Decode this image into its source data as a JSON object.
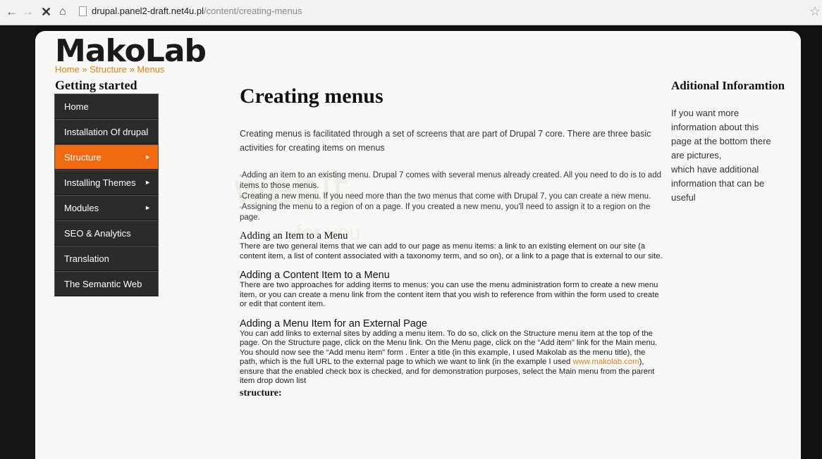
{
  "browser": {
    "back_icon": "←",
    "forward_icon": "→",
    "stop_icon": "✕",
    "home_icon": "⌂",
    "url_host": "drupal.panel2-draft.net4u.pl",
    "url_path": "/content/creating-menus",
    "star_icon": "☆"
  },
  "site": {
    "logo": "MakoLab",
    "breadcrumb": [
      "Home",
      "Structure",
      "Menus"
    ],
    "breadcrumb_sep": "»",
    "watermark": "webit",
    "watermark_sub": "for you"
  },
  "sidebar": {
    "title": "Getting started",
    "items": [
      {
        "label": "Home",
        "arrow": ""
      },
      {
        "label": "Installation Of drupal",
        "arrow": ""
      },
      {
        "label": "Structure",
        "arrow": "►"
      },
      {
        "label": "Installing Themes",
        "arrow": "►"
      },
      {
        "label": "Modules",
        "arrow": "►"
      },
      {
        "label": "SEO & Analytics",
        "arrow": ""
      },
      {
        "label": "Translation",
        "arrow": ""
      },
      {
        "label": "The Semantic Web",
        "arrow": ""
      }
    ]
  },
  "main": {
    "title": "Creating menus",
    "intro": "Creating menus is facilitated through a set of screens that are part of Drupal 7 core. There are three basic activities for creating items on menus",
    "bullets": [
      "Adding an item to an existing menu. Drupal 7 comes with several menus already created. All you need to do is to add items to those menus.",
      "Creating a new menu. If you need more than the two menus that come with Drupal 7, you can create a new menu.",
      "Assigning the menu to a region of on a page. If you created a new menu, you'll need to assign it to a region on the page."
    ],
    "bullet_mark": "▫",
    "s1_heading": "Adding an Item to a Menu",
    "s1_text": "There are two general items that we can add to our page as menu items: a link to an existing element on our site (a content item, a list of content associated with a taxonomy term, and so on), or a link to a page that is external to our site.",
    "s2_heading": "Adding a Content Item to a Menu",
    "s2_text": "There are two approaches for adding items to menus: you can use the menu administration form  to create a new menu item, or you can create a menu link from the content item that you wish to reference from within the form used to create or edit that content item.",
    "s3_heading": "Adding a Menu Item for an External Page",
    "s3_text_a": "You can add links to external sites by adding a menu item. To do so, click on the Structure menu item at the top of the page. On the Structure page, click on the Menu link. On the Menu page, click on the “Add item” link for the Main menu. You should now see the “Add menu item” form . Enter a title (in this example, I used Makolab as the menu title), the path, which is the full URL to the external page to which we want to link (in the example I used ",
    "s3_link": "www.makolab.com",
    "s3_text_b": "), ensure that the enabled check box is checked, and for demonstration purposes, select the Main menu from the parent item drop down list",
    "structure_label": "structure:"
  },
  "aside": {
    "title": "Aditional Inforamtion",
    "text_lines": [
      "If you want more",
      "information about this",
      "page at the bottom there",
      "are pictures,",
      "which have additional",
      "information that can be",
      "useful"
    ]
  }
}
